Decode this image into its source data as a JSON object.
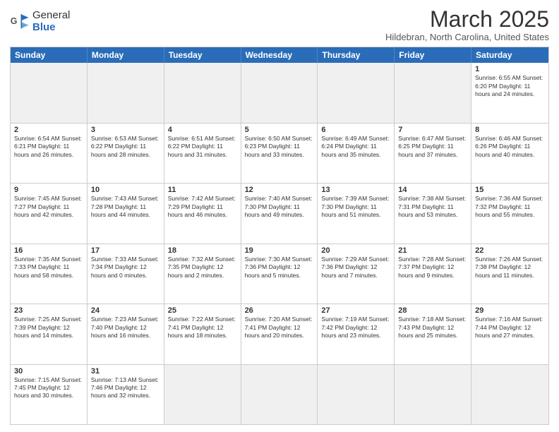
{
  "header": {
    "logo_general": "General",
    "logo_blue": "Blue",
    "month_title": "March 2025",
    "location": "Hildebran, North Carolina, United States"
  },
  "weekdays": [
    "Sunday",
    "Monday",
    "Tuesday",
    "Wednesday",
    "Thursday",
    "Friday",
    "Saturday"
  ],
  "weeks": [
    [
      {
        "day": "",
        "info": ""
      },
      {
        "day": "",
        "info": ""
      },
      {
        "day": "",
        "info": ""
      },
      {
        "day": "",
        "info": ""
      },
      {
        "day": "",
        "info": ""
      },
      {
        "day": "",
        "info": ""
      },
      {
        "day": "1",
        "info": "Sunrise: 6:55 AM\nSunset: 6:20 PM\nDaylight: 11 hours\nand 24 minutes."
      }
    ],
    [
      {
        "day": "2",
        "info": "Sunrise: 6:54 AM\nSunset: 6:21 PM\nDaylight: 11 hours\nand 26 minutes."
      },
      {
        "day": "3",
        "info": "Sunrise: 6:53 AM\nSunset: 6:22 PM\nDaylight: 11 hours\nand 28 minutes."
      },
      {
        "day": "4",
        "info": "Sunrise: 6:51 AM\nSunset: 6:22 PM\nDaylight: 11 hours\nand 31 minutes."
      },
      {
        "day": "5",
        "info": "Sunrise: 6:50 AM\nSunset: 6:23 PM\nDaylight: 11 hours\nand 33 minutes."
      },
      {
        "day": "6",
        "info": "Sunrise: 6:49 AM\nSunset: 6:24 PM\nDaylight: 11 hours\nand 35 minutes."
      },
      {
        "day": "7",
        "info": "Sunrise: 6:47 AM\nSunset: 6:25 PM\nDaylight: 11 hours\nand 37 minutes."
      },
      {
        "day": "8",
        "info": "Sunrise: 6:46 AM\nSunset: 6:26 PM\nDaylight: 11 hours\nand 40 minutes."
      }
    ],
    [
      {
        "day": "9",
        "info": "Sunrise: 7:45 AM\nSunset: 7:27 PM\nDaylight: 11 hours\nand 42 minutes."
      },
      {
        "day": "10",
        "info": "Sunrise: 7:43 AM\nSunset: 7:28 PM\nDaylight: 11 hours\nand 44 minutes."
      },
      {
        "day": "11",
        "info": "Sunrise: 7:42 AM\nSunset: 7:29 PM\nDaylight: 11 hours\nand 46 minutes."
      },
      {
        "day": "12",
        "info": "Sunrise: 7:40 AM\nSunset: 7:30 PM\nDaylight: 11 hours\nand 49 minutes."
      },
      {
        "day": "13",
        "info": "Sunrise: 7:39 AM\nSunset: 7:30 PM\nDaylight: 11 hours\nand 51 minutes."
      },
      {
        "day": "14",
        "info": "Sunrise: 7:38 AM\nSunset: 7:31 PM\nDaylight: 11 hours\nand 53 minutes."
      },
      {
        "day": "15",
        "info": "Sunrise: 7:36 AM\nSunset: 7:32 PM\nDaylight: 11 hours\nand 55 minutes."
      }
    ],
    [
      {
        "day": "16",
        "info": "Sunrise: 7:35 AM\nSunset: 7:33 PM\nDaylight: 11 hours\nand 58 minutes."
      },
      {
        "day": "17",
        "info": "Sunrise: 7:33 AM\nSunset: 7:34 PM\nDaylight: 12 hours\nand 0 minutes."
      },
      {
        "day": "18",
        "info": "Sunrise: 7:32 AM\nSunset: 7:35 PM\nDaylight: 12 hours\nand 2 minutes."
      },
      {
        "day": "19",
        "info": "Sunrise: 7:30 AM\nSunset: 7:36 PM\nDaylight: 12 hours\nand 5 minutes."
      },
      {
        "day": "20",
        "info": "Sunrise: 7:29 AM\nSunset: 7:36 PM\nDaylight: 12 hours\nand 7 minutes."
      },
      {
        "day": "21",
        "info": "Sunrise: 7:28 AM\nSunset: 7:37 PM\nDaylight: 12 hours\nand 9 minutes."
      },
      {
        "day": "22",
        "info": "Sunrise: 7:26 AM\nSunset: 7:38 PM\nDaylight: 12 hours\nand 11 minutes."
      }
    ],
    [
      {
        "day": "23",
        "info": "Sunrise: 7:25 AM\nSunset: 7:39 PM\nDaylight: 12 hours\nand 14 minutes."
      },
      {
        "day": "24",
        "info": "Sunrise: 7:23 AM\nSunset: 7:40 PM\nDaylight: 12 hours\nand 16 minutes."
      },
      {
        "day": "25",
        "info": "Sunrise: 7:22 AM\nSunset: 7:41 PM\nDaylight: 12 hours\nand 18 minutes."
      },
      {
        "day": "26",
        "info": "Sunrise: 7:20 AM\nSunset: 7:41 PM\nDaylight: 12 hours\nand 20 minutes."
      },
      {
        "day": "27",
        "info": "Sunrise: 7:19 AM\nSunset: 7:42 PM\nDaylight: 12 hours\nand 23 minutes."
      },
      {
        "day": "28",
        "info": "Sunrise: 7:18 AM\nSunset: 7:43 PM\nDaylight: 12 hours\nand 25 minutes."
      },
      {
        "day": "29",
        "info": "Sunrise: 7:16 AM\nSunset: 7:44 PM\nDaylight: 12 hours\nand 27 minutes."
      }
    ],
    [
      {
        "day": "30",
        "info": "Sunrise: 7:15 AM\nSunset: 7:45 PM\nDaylight: 12 hours\nand 30 minutes."
      },
      {
        "day": "31",
        "info": "Sunrise: 7:13 AM\nSunset: 7:46 PM\nDaylight: 12 hours\nand 32 minutes."
      },
      {
        "day": "",
        "info": ""
      },
      {
        "day": "",
        "info": ""
      },
      {
        "day": "",
        "info": ""
      },
      {
        "day": "",
        "info": ""
      },
      {
        "day": "",
        "info": ""
      }
    ]
  ]
}
